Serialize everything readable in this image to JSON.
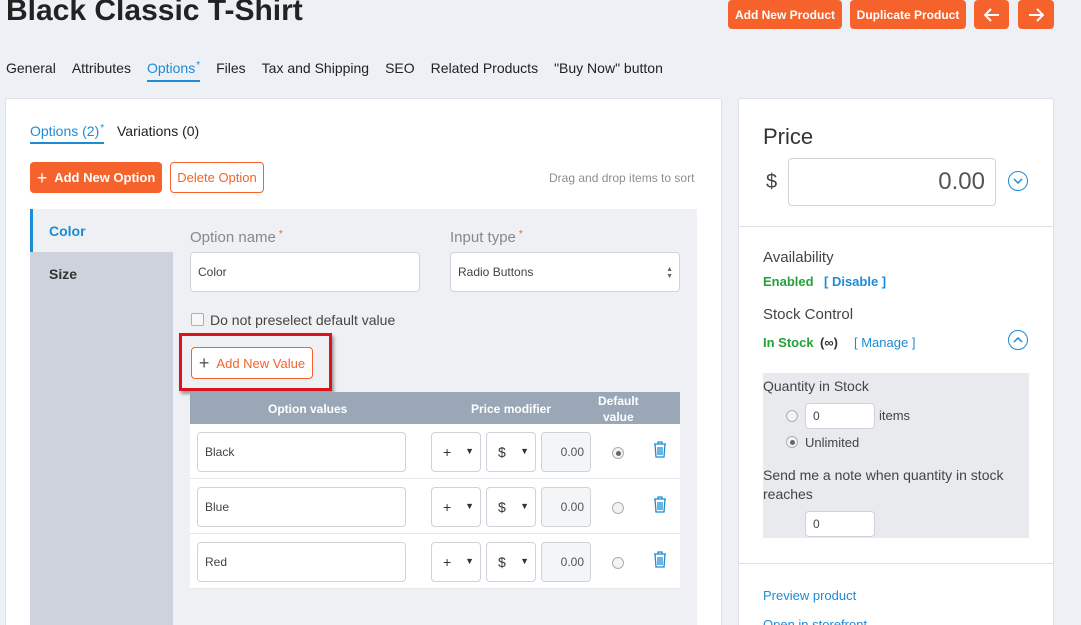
{
  "page": {
    "title": "Black Classic T-Shirt"
  },
  "header_buttons": {
    "add_new_product": "Add New Product",
    "duplicate_product": "Duplicate Product",
    "prev_icon": "arrow-left-icon",
    "next_icon": "arrow-right-icon"
  },
  "tabs": [
    {
      "label": "General"
    },
    {
      "label": "Attributes"
    },
    {
      "label": "Options",
      "active": true,
      "marker": "*"
    },
    {
      "label": "Files"
    },
    {
      "label": "Tax and Shipping"
    },
    {
      "label": "SEO"
    },
    {
      "label": "Related Products"
    },
    {
      "label": "\"Buy Now\" button"
    }
  ],
  "subtabs": [
    {
      "label": "Options (2)",
      "marker": "*"
    },
    {
      "label": "Variations (0)"
    }
  ],
  "option_actions": {
    "add_new_option": "Add New Option",
    "delete_option": "Delete Option",
    "drag_hint": "Drag and drop items to sort"
  },
  "option_list": [
    {
      "label": "Color"
    },
    {
      "label": "Size"
    }
  ],
  "option_form": {
    "name_label": "Option name",
    "name_value": "Color",
    "input_type_label": "Input type",
    "input_type_value": "Radio Buttons",
    "required_marker": "*",
    "no_preselect_label": "Do not preselect default value",
    "add_new_value": "Add New Value"
  },
  "values_table": {
    "headers": {
      "option_values": "Option values",
      "price_modifier": "Price modifier",
      "default_value_line1": "Default",
      "default_value_line2": "value"
    },
    "rows": [
      {
        "name": "Black",
        "sign": "+",
        "unit": "$",
        "amount": "0.00",
        "default": true
      },
      {
        "name": "Blue",
        "sign": "+",
        "unit": "$",
        "amount": "0.00",
        "default": false
      },
      {
        "name": "Red",
        "sign": "+",
        "unit": "$",
        "amount": "0.00",
        "default": false
      }
    ]
  },
  "price_panel": {
    "title": "Price",
    "currency": "$",
    "value": "0.00"
  },
  "availability": {
    "label": "Availability",
    "status": "Enabled",
    "action": "[ Disable ]"
  },
  "stock": {
    "label": "Stock Control",
    "status": "In Stock",
    "infinity": "(∞)",
    "manage": "[ Manage ]",
    "quantity_label": "Quantity in Stock",
    "quantity_value": "0",
    "items_label": "items",
    "unlimited_label": "Unlimited",
    "note_label": "Send me a note when quantity in stock reaches",
    "note_value": "0"
  },
  "links": {
    "preview": "Preview product",
    "storefront": "Open in storefront"
  },
  "colors": {
    "accent_orange": "#f5622b",
    "link_blue": "#1d8bd6",
    "status_green": "#25a13a",
    "highlight_red": "#d9141b"
  }
}
